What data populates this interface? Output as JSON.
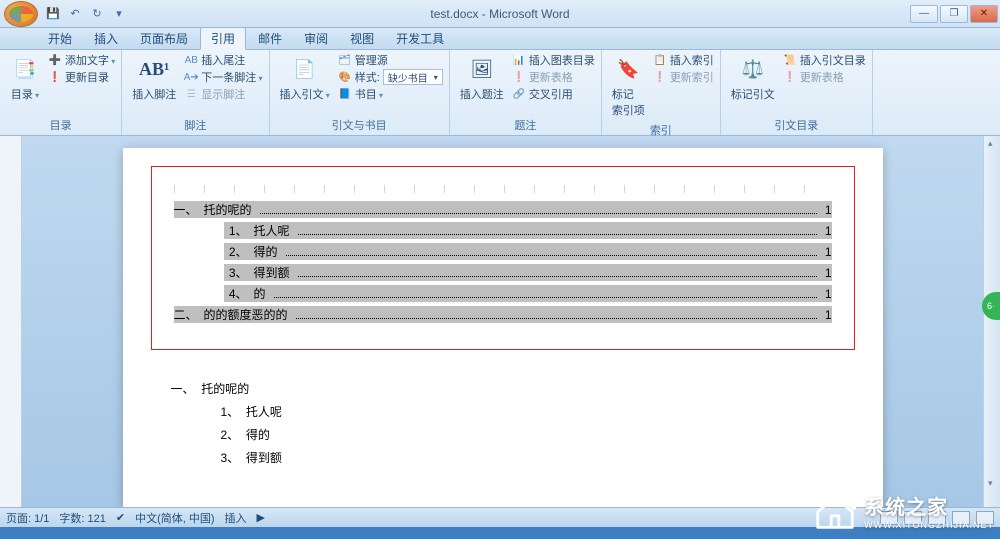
{
  "titlebar": {
    "title": "test.docx - Microsoft Word"
  },
  "qat": {
    "save": "💾",
    "undo": "↶",
    "redo": "↻",
    "more": "▾"
  },
  "winbtns": {
    "min": "—",
    "max": "❐",
    "close": "✕"
  },
  "tabs": [
    "开始",
    "插入",
    "页面布局",
    "引用",
    "邮件",
    "审阅",
    "视图",
    "开发工具"
  ],
  "active_tab": 3,
  "ribbon": {
    "g1": {
      "label": "目录",
      "big": "目录",
      "rows": [
        "添加文字",
        "更新目录"
      ]
    },
    "g2": {
      "label": "脚注",
      "big": "插入脚注",
      "ab": "AB¹",
      "rows": [
        "插入尾注",
        "下一条脚注",
        "显示脚注"
      ]
    },
    "g3": {
      "label": "引文与书目",
      "big": "插入引文",
      "rows": [
        "管理源",
        "样式:",
        "书目"
      ],
      "stylebox": "缺少书目"
    },
    "g4": {
      "label": "题注",
      "big": "插入题注",
      "rows": [
        "插入图表目录",
        "更新表格",
        "交叉引用"
      ]
    },
    "g5": {
      "label": "索引",
      "big": "标记\n索引项",
      "rows": [
        "插入索引",
        "更新索引"
      ]
    },
    "g6": {
      "label": "引文目录",
      "big": "标记引文",
      "rows": [
        "插入引文目录",
        "更新表格"
      ]
    }
  },
  "toc": [
    {
      "lvl": 1,
      "num": "一、",
      "txt": "托的呢的",
      "pg": "1"
    },
    {
      "lvl": 2,
      "num": "1、",
      "txt": "托人呢",
      "pg": "1"
    },
    {
      "lvl": 2,
      "num": "2、",
      "txt": "得的",
      "pg": "1"
    },
    {
      "lvl": 2,
      "num": "3、",
      "txt": "得到额",
      "pg": "1"
    },
    {
      "lvl": 2,
      "num": "4、",
      "txt": "的",
      "pg": "1"
    },
    {
      "lvl": 1,
      "num": "二、",
      "txt": "的的额度恶的的",
      "pg": "1"
    }
  ],
  "body": [
    {
      "lvl": 1,
      "num": "一、",
      "txt": "托的呢的"
    },
    {
      "lvl": 2,
      "num": "1、",
      "txt": "托人呢"
    },
    {
      "lvl": 2,
      "num": "2、",
      "txt": "得的"
    },
    {
      "lvl": 2,
      "num": "3、",
      "txt": "得到额"
    }
  ],
  "status": {
    "page": "页面: 1/1",
    "words": "字数: 121",
    "lang": "中文(简体, 中国)",
    "mode": "插入"
  },
  "watermark": {
    "cn": "系统之家",
    "en": "WWW.XITONGZHIJIA.NET"
  },
  "badge": "6·"
}
